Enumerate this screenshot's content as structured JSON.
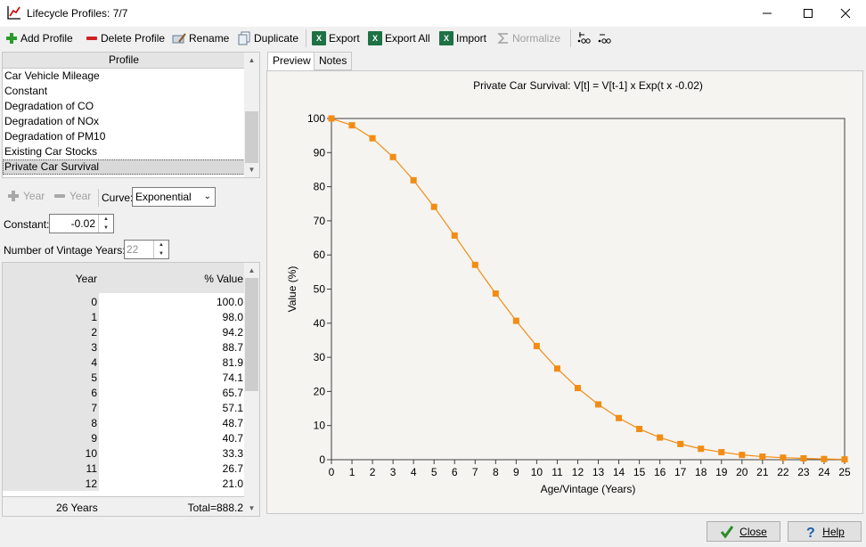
{
  "window": {
    "title": "Lifecycle Profiles: 7/7"
  },
  "toolbar": {
    "add_profile": "Add Profile",
    "delete_profile": "Delete Profile",
    "rename": "Rename",
    "duplicate": "Duplicate",
    "export": "Export",
    "export_all": "Export All",
    "import": "Import",
    "normalize": "Normalize",
    "xl_glyph": "X"
  },
  "profiles": {
    "header": "Profile",
    "items": [
      "Car Vehicle Mileage",
      "Constant",
      "Degradation of CO",
      "Degradation of NOx",
      "Degradation of PM10",
      "Existing Car Stocks",
      "Private Car Survival"
    ],
    "selected": "Private Car Survival"
  },
  "year_controls": {
    "add_year": "Year",
    "remove_year": "Year",
    "curve_label": "Curve:",
    "curve_value": "Exponential"
  },
  "constant": {
    "label": "Constant:",
    "value": "-0.02"
  },
  "vintage": {
    "label": "Number of Vintage Years:",
    "value": "22"
  },
  "year_table": {
    "col_year": "Year",
    "col_value": "% Value",
    "rows": [
      {
        "year": "0",
        "value": "100.0"
      },
      {
        "year": "1",
        "value": "98.0"
      },
      {
        "year": "2",
        "value": "94.2"
      },
      {
        "year": "3",
        "value": "88.7"
      },
      {
        "year": "4",
        "value": "81.9"
      },
      {
        "year": "5",
        "value": "74.1"
      },
      {
        "year": "6",
        "value": "65.7"
      },
      {
        "year": "7",
        "value": "57.1"
      },
      {
        "year": "8",
        "value": "48.7"
      },
      {
        "year": "9",
        "value": "40.7"
      },
      {
        "year": "10",
        "value": "33.3"
      },
      {
        "year": "11",
        "value": "26.7"
      },
      {
        "year": "12",
        "value": "21.0"
      }
    ],
    "footer_years": "26 Years",
    "footer_total": "Total=888.2"
  },
  "tabs": {
    "preview": "Preview",
    "notes": "Notes"
  },
  "chart_data": {
    "type": "line",
    "title": "Private Car Survival: V[t] = V[t-1] x Exp(t x -0.02)",
    "xlabel": "Age/Vintage (Years)",
    "ylabel": "Value (%)",
    "xlim": [
      0,
      25
    ],
    "ylim": [
      0,
      100
    ],
    "x_ticks": [
      0,
      1,
      2,
      3,
      4,
      5,
      6,
      7,
      8,
      9,
      10,
      11,
      12,
      13,
      14,
      15,
      16,
      17,
      18,
      19,
      20,
      21,
      22,
      23,
      24,
      25
    ],
    "y_ticks": [
      0,
      10,
      20,
      30,
      40,
      50,
      60,
      70,
      80,
      90,
      100
    ],
    "series": [
      {
        "color": "#f28c13",
        "x": [
          0,
          1,
          2,
          3,
          4,
          5,
          6,
          7,
          8,
          9,
          10,
          11,
          12,
          13,
          14,
          15,
          16,
          17,
          18,
          19,
          20,
          21,
          22,
          23,
          24,
          25
        ],
        "values": [
          100.0,
          98.0,
          94.2,
          88.7,
          81.9,
          74.1,
          65.7,
          57.1,
          48.7,
          40.7,
          33.3,
          26.7,
          21.0,
          16.2,
          12.2,
          9.0,
          6.5,
          4.6,
          3.2,
          2.2,
          1.4,
          0.9,
          0.6,
          0.4,
          0.2,
          0.1
        ]
      }
    ],
    "grid": false
  },
  "buttons": {
    "close": "Close",
    "help": "Help"
  }
}
